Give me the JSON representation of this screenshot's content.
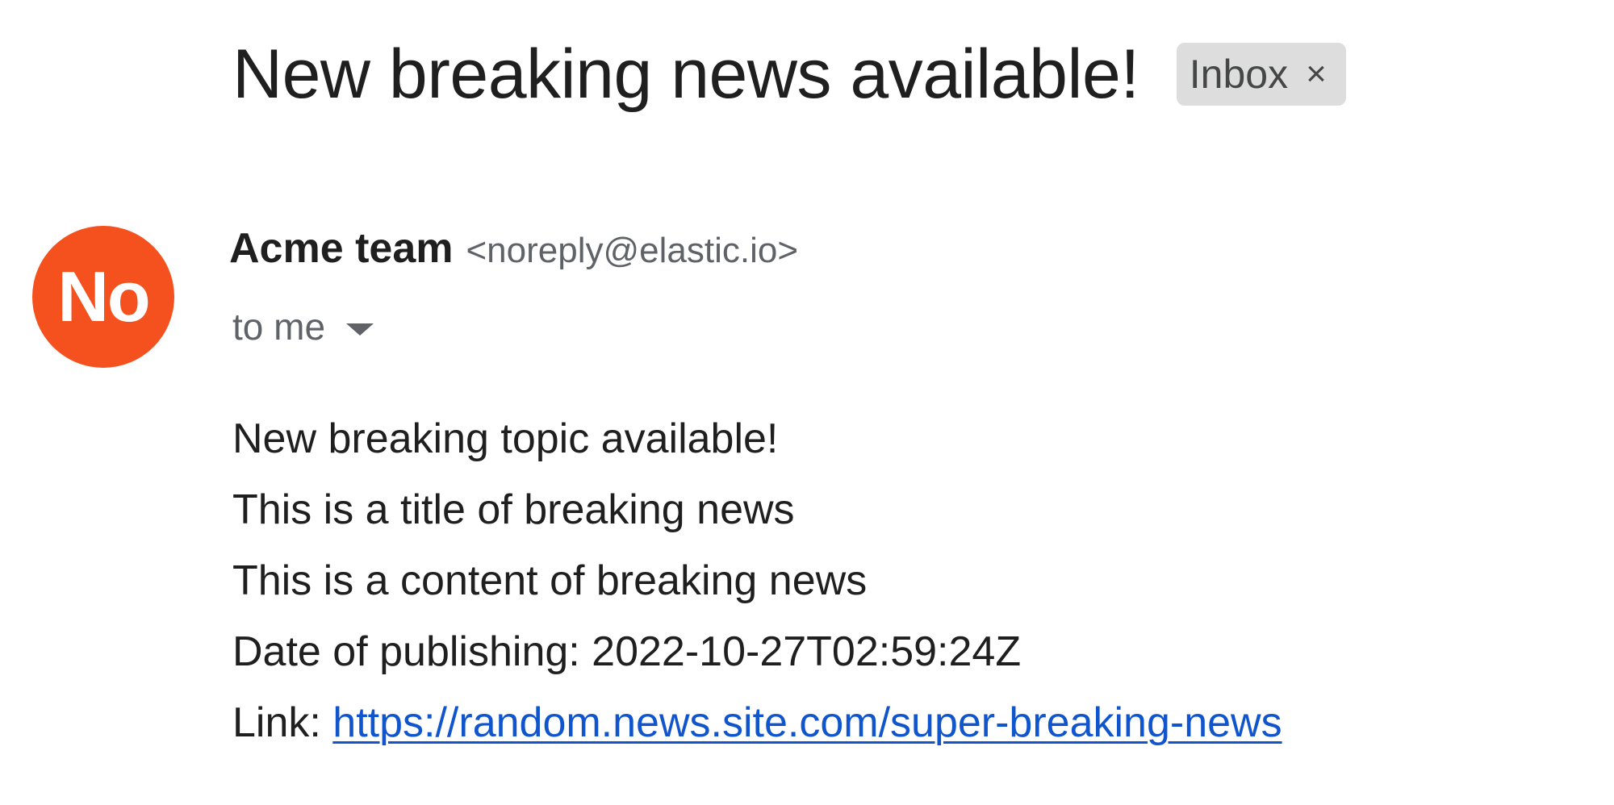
{
  "email": {
    "subject": "New breaking news available!",
    "label": {
      "text": "Inbox",
      "close_glyph": "×"
    },
    "sender": {
      "avatar_initials": "No",
      "avatar_color": "#f4511e",
      "name": "Acme team",
      "email": "<noreply@elastic.io>"
    },
    "recipient_text": "to me",
    "body": {
      "line1": "New breaking topic available!",
      "line2": "This is a title of breaking news",
      "line3": "This is a content of breaking news",
      "line4": "Date of publishing: 2022-10-27T02:59:24Z",
      "link_prefix": "Link: ",
      "link_text": "https://random.news.site.com/super-breaking-news",
      "link_color": "#1155cc"
    }
  }
}
